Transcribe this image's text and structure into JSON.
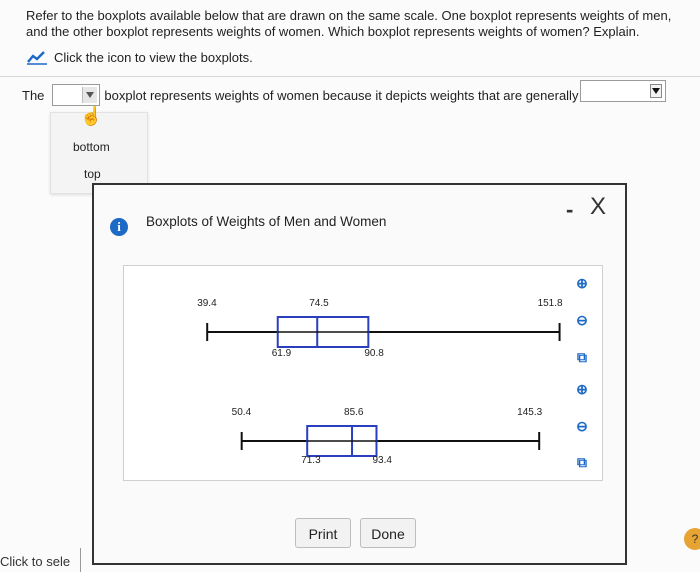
{
  "question": {
    "text": "Refer to the boxplots available below that are drawn on the same scale. One boxplot represents weights of men, and the other boxplot represents weights of women. Which boxplot represents weights of women? Explain.",
    "hint": "Click the icon to view the boxplots."
  },
  "answer": {
    "prefix": "The",
    "middle": "boxplot represents weights of women because it depicts weights that are generally",
    "dropdown1_value": "",
    "dropdown2_value": ""
  },
  "menu": {
    "options": [
      "bottom",
      "top"
    ]
  },
  "dialog": {
    "title": "Boxplots of Weights of Men and Women",
    "print_label": "Print",
    "done_label": "Done",
    "minimize_symbol": "-",
    "close_symbol": "X"
  },
  "footer": {
    "text": "Click to sele"
  },
  "help_symbol": "?",
  "chart_data": {
    "type": "boxplot",
    "title": "",
    "xlim": [
      32,
      158
    ],
    "series": [
      {
        "min": 39.4,
        "q1": 61.9,
        "median": 74.5,
        "q3": 90.8,
        "max": 151.8
      },
      {
        "min": 50.4,
        "q1": 71.3,
        "median": 85.6,
        "q3": 93.4,
        "max": 145.3
      }
    ],
    "labels": [
      [
        "39.4",
        "61.9",
        "74.5",
        "90.8",
        "151.8"
      ],
      [
        "50.4",
        "71.3",
        "85.6",
        "93.4",
        "145.3"
      ]
    ],
    "box_color": "#2a3fbf"
  }
}
